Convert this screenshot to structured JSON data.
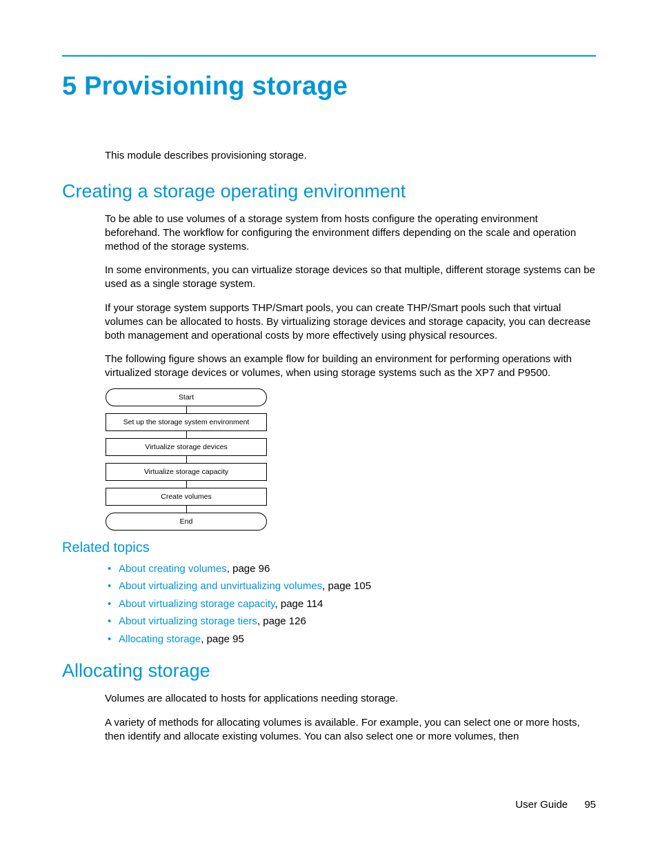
{
  "chapter": {
    "number": "5",
    "title": "Provisioning storage"
  },
  "intro": "This module describes provisioning storage.",
  "sections": {
    "creating": {
      "heading": "Creating a storage operating environment",
      "p1": "To be able to use volumes of a storage system from hosts configure the operating environment beforehand. The workflow for configuring the environment differs depending on the scale and operation method of the storage systems.",
      "p2": "In some environments, you can virtualize storage devices so that multiple, different storage systems can be used as a single storage system.",
      "p3": "If your storage system supports THP/Smart pools, you can create THP/Smart pools such that virtual volumes can be allocated to hosts. By virtualizing storage devices and storage capacity, you can decrease both management and operational costs by more effectively using physical resources.",
      "p4": "The following figure shows an example flow for building an environment for performing operations with virtualized storage devices or volumes, when using storage systems such as the XP7 and P9500."
    },
    "flowchart": {
      "start": "Start",
      "step1": "Set up the storage system environment",
      "step2": "Virtualize storage devices",
      "step3": "Virtualize storage capacity",
      "step4": "Create volumes",
      "end": "End"
    },
    "related": {
      "heading": "Related topics",
      "items": [
        {
          "link": "About creating volumes",
          "suffix": ", page 96"
        },
        {
          "link": "About virtualizing and unvirtualizing volumes",
          "suffix": ", page 105"
        },
        {
          "link": "About virtualizing storage capacity",
          "suffix": ", page 114"
        },
        {
          "link": "About virtualizing storage tiers",
          "suffix": ", page 126"
        },
        {
          "link": "Allocating storage",
          "suffix": ", page 95"
        }
      ]
    },
    "allocating": {
      "heading": "Allocating storage",
      "p1": "Volumes are allocated to hosts for applications needing storage.",
      "p2": "A variety of methods for allocating volumes is available. For example, you can select one or more hosts, then identify and allocate existing volumes. You can also select one or more volumes, then"
    }
  },
  "footer": {
    "label": "User Guide",
    "page": "95"
  }
}
